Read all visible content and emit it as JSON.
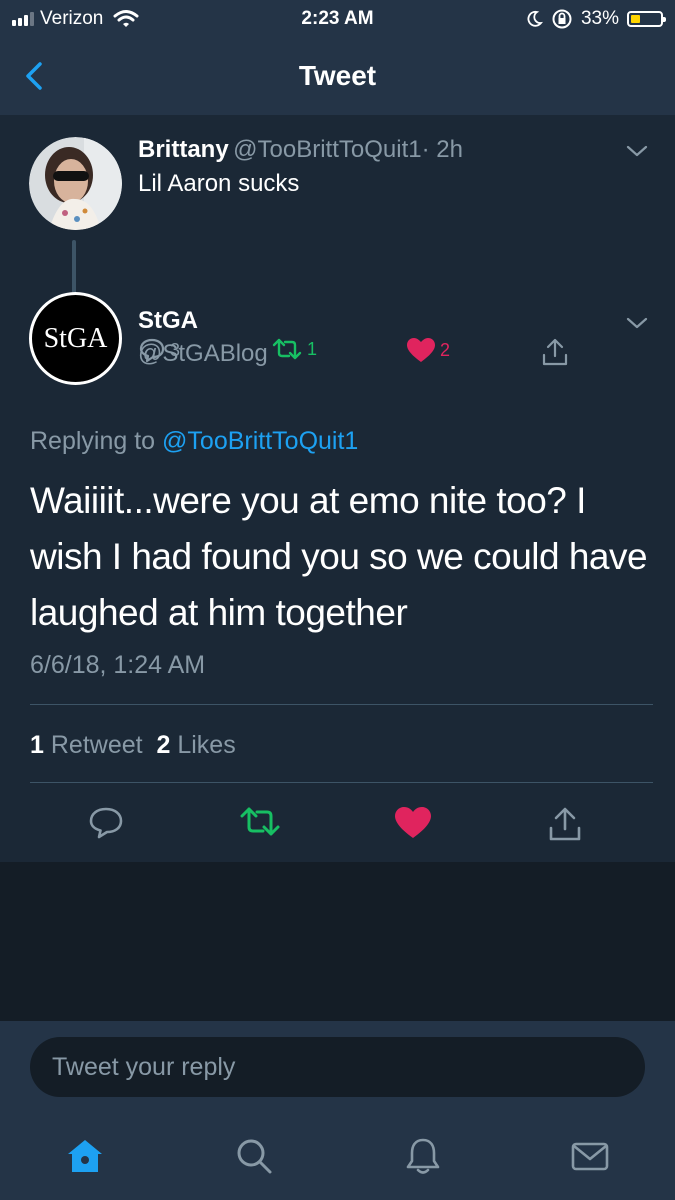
{
  "status_bar": {
    "carrier": "Verizon",
    "time": "2:23 AM",
    "battery": "33%",
    "battery_level": 0.33
  },
  "header": {
    "title": "Tweet"
  },
  "parent_tweet": {
    "name": "Brittany",
    "handle": "@TooBrittToQuit1",
    "time": "· 2h",
    "text": "Lil Aaron sucks",
    "replies": "3",
    "retweets": "1",
    "likes": "2"
  },
  "main_tweet": {
    "avatar_text": "StGA",
    "name": "StGA",
    "handle": "@StGABlog",
    "replying_label": "Replying to",
    "replying_handle": "@TooBrittToQuit1",
    "text": "Waiiiit...were you at emo nite too?  I wish I had found you so we could have laughed at him together",
    "date": "6/6/18, 1:24 AM",
    "retweet_count": "1",
    "retweet_label": "Retweet",
    "like_count": "2",
    "like_label": "Likes"
  },
  "reply_box": {
    "placeholder": "Tweet your reply"
  },
  "colors": {
    "accent": "#1da1f2",
    "retweet": "#17bf63",
    "like": "#e0245e",
    "background": "#141d26",
    "card": "#1b2836",
    "bar": "#243447"
  },
  "tabbar": {
    "items": [
      "home-icon",
      "search-icon",
      "notifications-icon",
      "messages-icon"
    ]
  }
}
